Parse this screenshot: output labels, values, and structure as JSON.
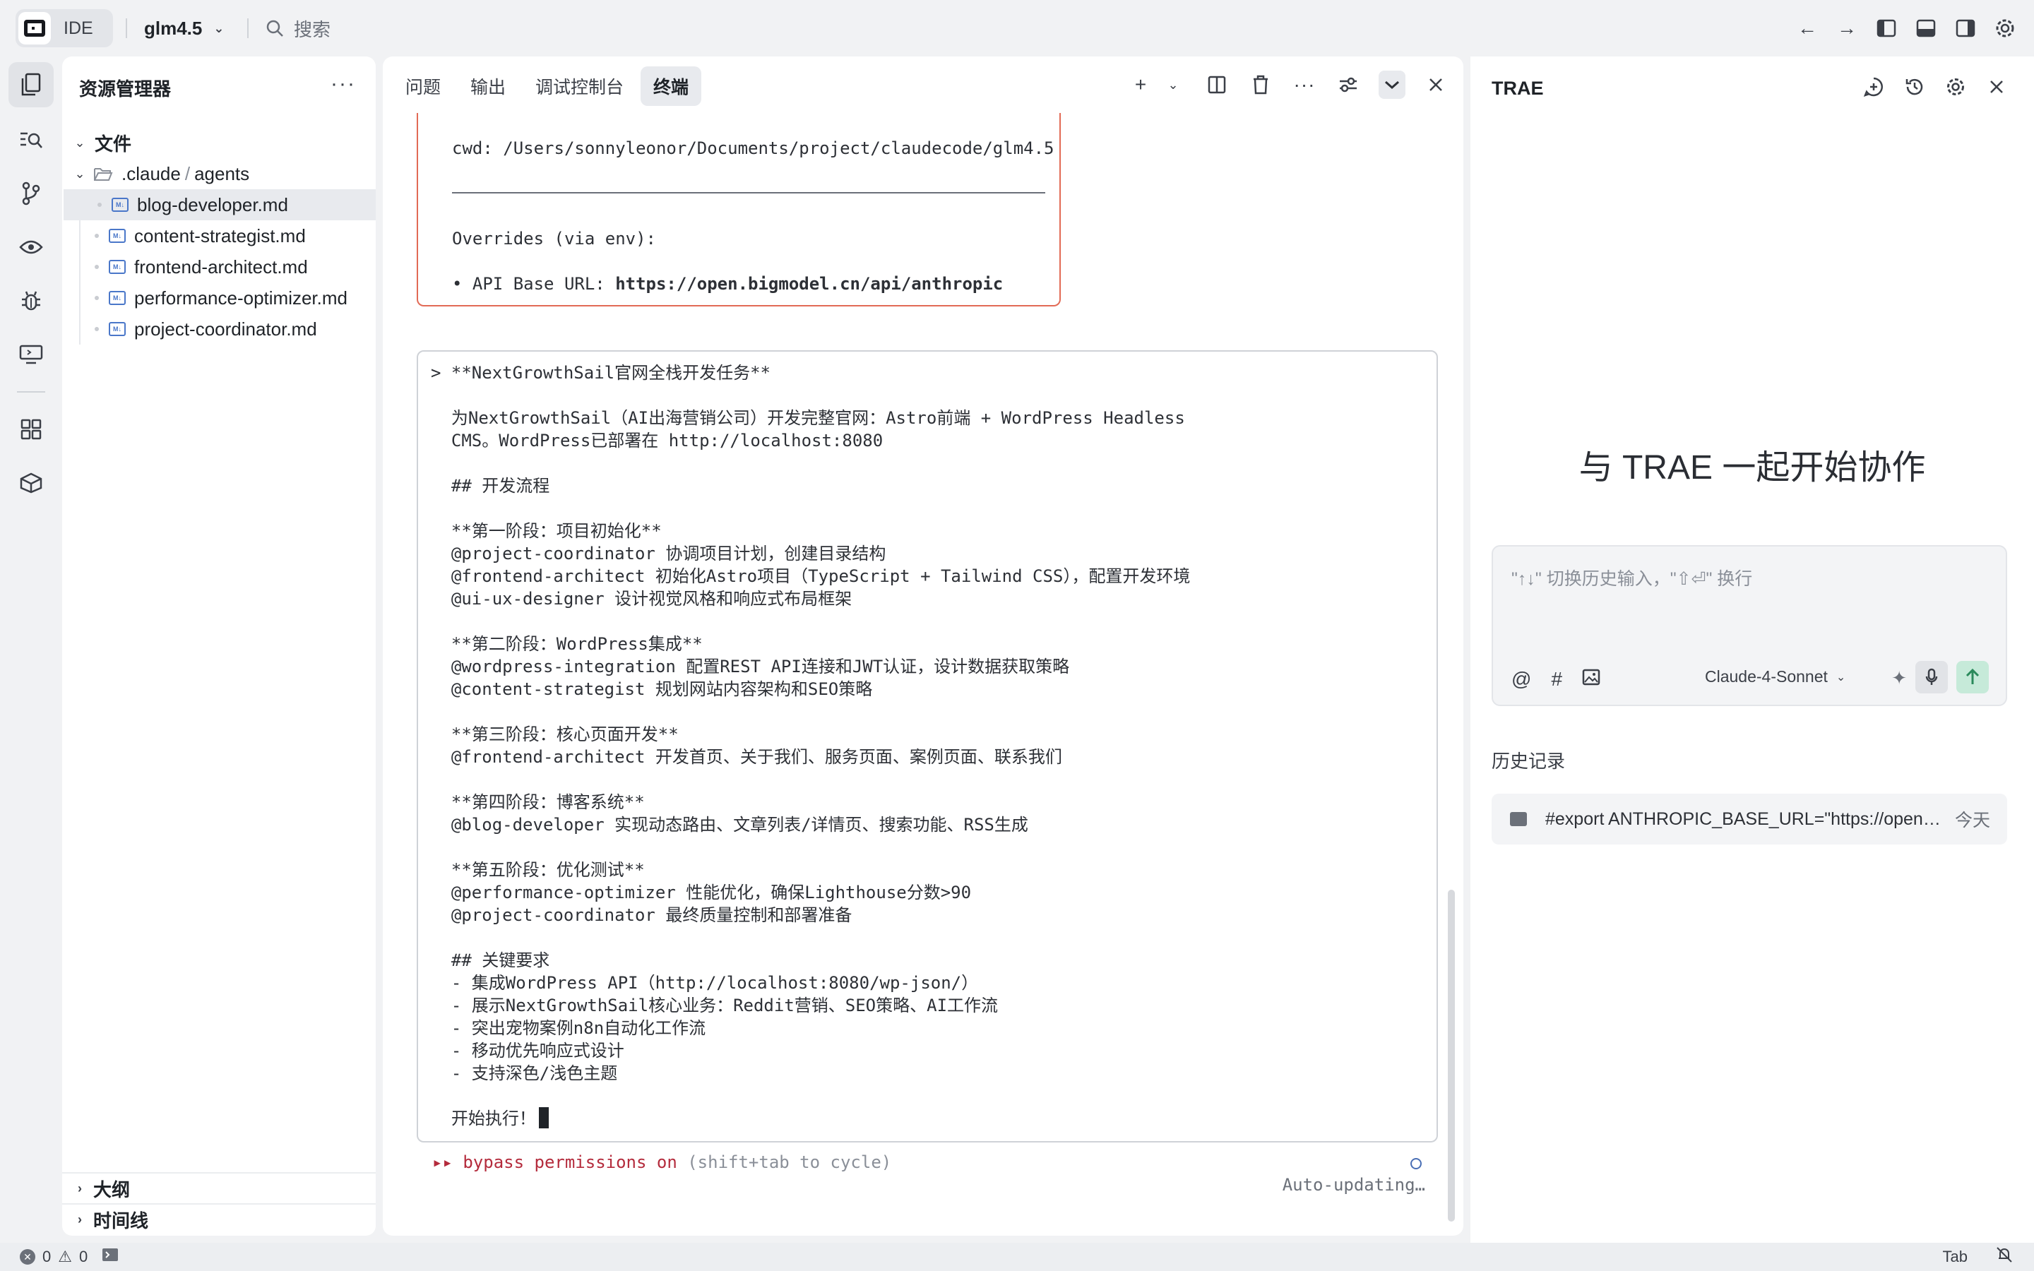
{
  "titlebar": {
    "ide_label": "IDE",
    "project": "glm4.5",
    "search_placeholder": "搜索"
  },
  "explorer": {
    "title": "资源管理器",
    "section_files": "文件",
    "folder": ".claude",
    "folder_sep": "/",
    "subfolder": "agents",
    "files": [
      "blog-developer.md",
      "content-strategist.md",
      "frontend-architect.md",
      "performance-optimizer.md",
      "project-coordinator.md"
    ],
    "selected_file": "blog-developer.md",
    "outline": "大纲",
    "timeline": "时间线"
  },
  "panel": {
    "tabs": [
      "问题",
      "输出",
      "调试控制台",
      "终端"
    ],
    "active_tab": "终端"
  },
  "terminal": {
    "cwd_line": "cwd: /Users/sonnyleonor/Documents/project/claudecode/glm4.5",
    "overrides_line": "Overrides (via env):",
    "api_prefix": "• API Base URL: ",
    "api_url": "https://open.bigmodel.cn/api/anthropic",
    "prompt_lines": [
      "> **NextGrowthSail官网全栈开发任务**",
      "",
      "  为NextGrowthSail（AI出海营销公司）开发完整官网：Astro前端 + WordPress Headless",
      "  CMS。WordPress已部署在 http://localhost:8080",
      "",
      "  ## 开发流程",
      "",
      "  **第一阶段：项目初始化**",
      "  @project-coordinator 协调项目计划，创建目录结构",
      "  @frontend-architect 初始化Astro项目（TypeScript + Tailwind CSS），配置开发环境",
      "  @ui-ux-designer 设计视觉风格和响应式布局框架",
      "",
      "  **第二阶段：WordPress集成**",
      "  @wordpress-integration 配置REST API连接和JWT认证，设计数据获取策略",
      "  @content-strategist 规划网站内容架构和SEO策略",
      "",
      "  **第三阶段：核心页面开发**",
      "  @frontend-architect 开发首页、关于我们、服务页面、案例页面、联系我们",
      "",
      "  **第四阶段：博客系统**",
      "  @blog-developer 实现动态路由、文章列表/详情页、搜索功能、RSS生成",
      "",
      "  **第五阶段：优化测试**",
      "  @performance-optimizer 性能优化，确保Lighthouse分数>90",
      "  @project-coordinator 最终质量控制和部署准备",
      "",
      "  ## 关键要求",
      "  - 集成WordPress API（http://localhost:8080/wp-json/）",
      "  - 展示NextGrowthSail核心业务：Reddit营销、SEO策略、AI工作流",
      "  - 突出宠物案例n8n自动化工作流",
      "  - 移动优先响应式设计",
      "  - 支持深色/浅色主题",
      ""
    ],
    "final_line": "  开始执行！",
    "bypass_label": "▸▸ bypass permissions on",
    "bypass_hint": " (shift+tab to cycle)",
    "auto_updating": "Auto-updating…"
  },
  "trae": {
    "title": "TRAE",
    "welcome": "与 TRAE 一起开始协作",
    "input_placeholder": "\"↑↓\" 切换历史输入，\"⇧⏎\" 换行",
    "model": "Claude-4-Sonnet",
    "history_title": "历史记录",
    "history_items": [
      {
        "text": "#export ANTHROPIC_BASE_URL=\"https://open.bigmodel.cn/api/anthropic\"",
        "time": "今天"
      }
    ]
  },
  "statusbar": {
    "errors": "0",
    "warnings": "0",
    "tab_label": "Tab"
  },
  "colors": {
    "accent_red": "#b42b3c",
    "border_red": "#e26a55",
    "send_green": "#c6ead9"
  }
}
